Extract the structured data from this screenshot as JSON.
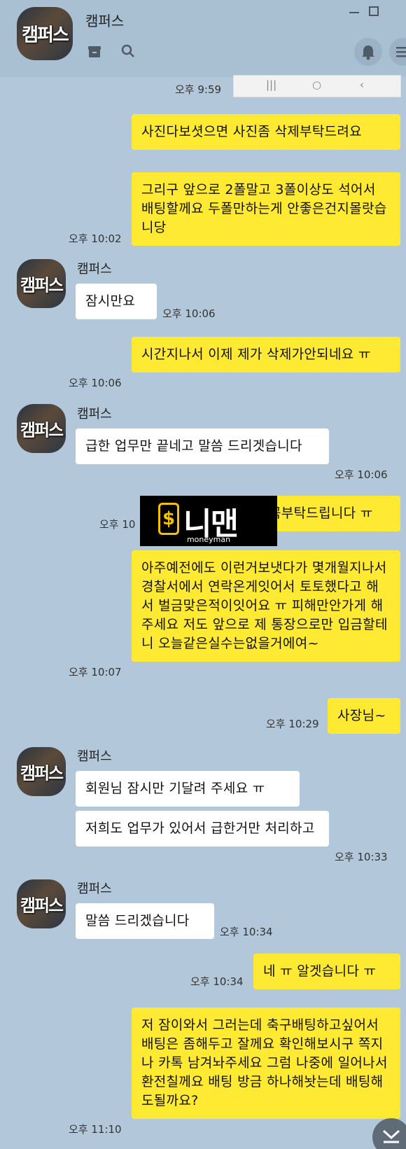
{
  "header": {
    "title": "캠퍼스",
    "avatar_label": "캠퍼스"
  },
  "status": {
    "top_time": "오후 9:59"
  },
  "messages": {
    "m1": "사진다보셧으면 사진좀 삭제부탁드려요",
    "m2": "그리구 앞으로 2폴말고 3폴이상도 석어서 배팅할께요 두폴만하는게 안좋은건지몰랏습니당",
    "m2_time": "오후 10:02",
    "m3_name": "캠퍼스",
    "m3": "잠시만요",
    "m3_time": "오후 10:06",
    "m4": "시간지나서 이제 제가 삭제가안되네요 ㅠ",
    "m4_time": "오후 10:06",
    "m5_name": "캠퍼스",
    "m5": "급한 업무만 끝네고 말씀 드리겟습니다",
    "m5_time": "오후 10:06",
    "m6": "꼭부탁드립니다 ㅠ",
    "m6_time": "오후 10",
    "m7": "아주예전에도 이런거보냇다가 몇개월지나서 경찰서에서 연락온게잇어서 토토했다고 해서 벌금맞은적이잇어요 ㅠ 피해만안가게 해주세요 저도 앞으로 제 통장으로만 입금할테니 오늘같은실수는없을거에여~",
    "m7_time": "오후 10:07",
    "m8": "사장님~",
    "m8_time": "오후 10:29",
    "m9_name": "캠퍼스",
    "m9": "회원님 잠시만 기달려 주세요 ㅠ",
    "m10": "저희도 업무가 있어서 급한거만 처리하고",
    "m10_time": "오후 10:33",
    "m11_name": "캠퍼스",
    "m11": "말씀 드리겠습니다",
    "m11_time": "오후 10:34",
    "m12": "네 ㅠ 알겟습니다 ㅠ",
    "m12_time": "오후 10:34",
    "m13": "저 잠이와서 그러는데 축구배팅하고싶어서 배팅은 좀해두고 잘께요 확인해보시구 쪽지나 카톡 남겨놔주세요 그럼 나중에 일어나서 환전칠께요 배팅 방금 하나해놧는데 배팅해도될까요?",
    "m13_time": "오후 11:10"
  },
  "watermark": {
    "main": "니맨",
    "dollar": "$",
    "sub": "moneyman"
  },
  "icons": {
    "minimize": "minimize-icon",
    "maximize": "maximize-icon",
    "folder": "folder-icon",
    "search": "search-icon",
    "bell": "bell-icon",
    "menu": "menu-icon",
    "scroll_down": "scroll-down-icon"
  },
  "colors": {
    "background": "#b2c7d9",
    "my_bubble": "#fee933",
    "other_bubble": "#ffffff"
  }
}
